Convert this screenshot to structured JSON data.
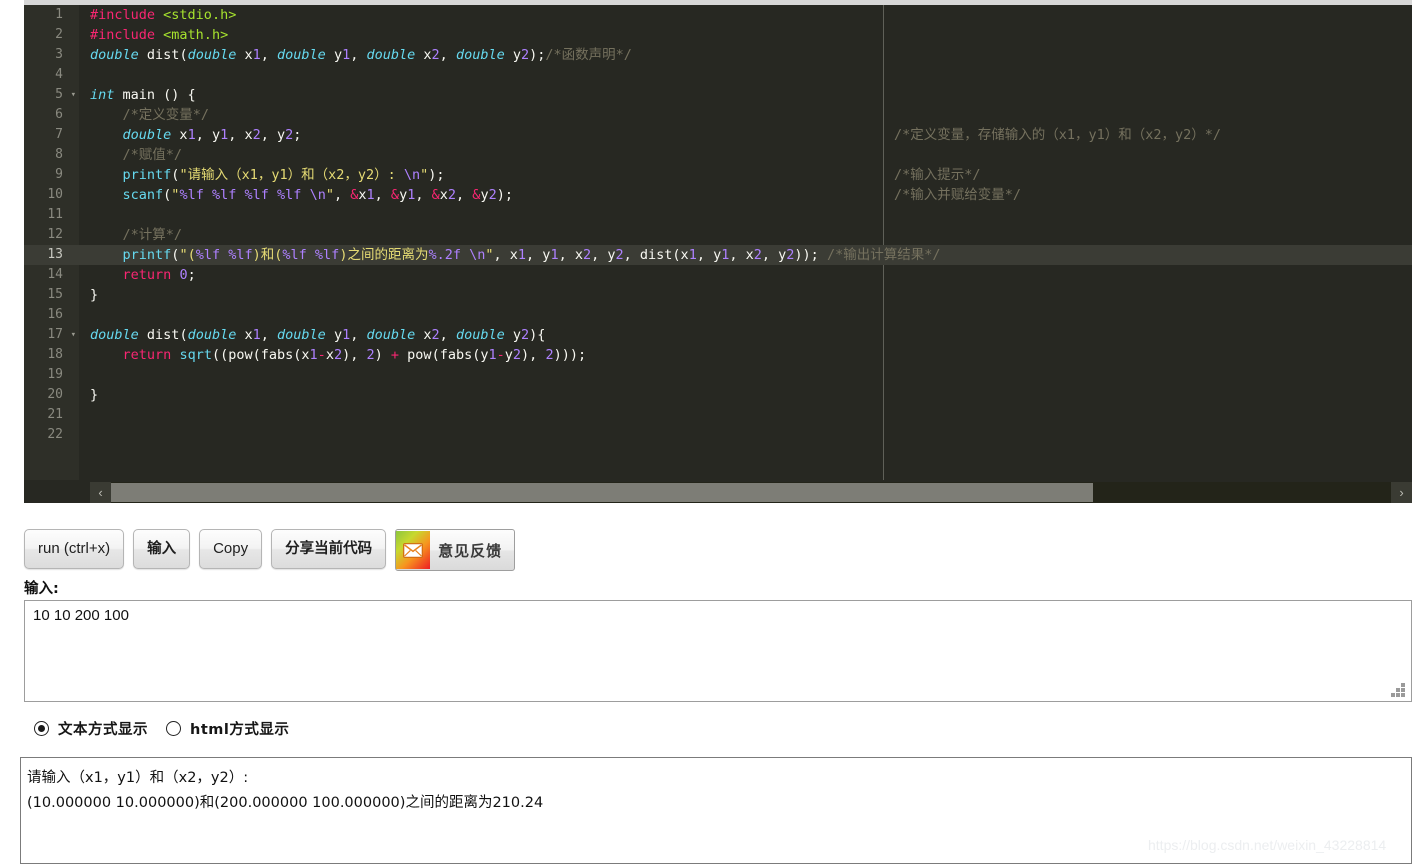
{
  "editor": {
    "background_color": "#272822",
    "gutter_color": "#2e2f28",
    "active_line": 13,
    "ruler_column_color": "#5f6058",
    "line_numbers": [
      "1",
      "2",
      "3",
      "4",
      "5",
      "6",
      "7",
      "8",
      "9",
      "10",
      "11",
      "12",
      "13",
      "14",
      "15",
      "16",
      "17",
      "18",
      "19",
      "20",
      "21",
      "22"
    ],
    "fold_markers": [
      5,
      17
    ],
    "lines": [
      {
        "n": 1,
        "code": "#include <stdio.h>",
        "tail_comment": ""
      },
      {
        "n": 2,
        "code": "#include <math.h>",
        "tail_comment": ""
      },
      {
        "n": 3,
        "code": "double dist(double x1, double y1, double x2, double y2);/*函数声明*/",
        "tail_comment": ""
      },
      {
        "n": 4,
        "code": "",
        "tail_comment": ""
      },
      {
        "n": 5,
        "code": "int main () {",
        "tail_comment": ""
      },
      {
        "n": 6,
        "code": "    /*定义变量*/",
        "tail_comment": ""
      },
      {
        "n": 7,
        "code": "    double x1, y1, x2, y2;",
        "tail_comment": "/*定义变量，存储输入的（x1，y1）和（x2，y2）*/"
      },
      {
        "n": 8,
        "code": "    /*赋值*/",
        "tail_comment": ""
      },
      {
        "n": 9,
        "code": "    printf(\"请输入（x1，y1）和（x2，y2）: \\n\");",
        "tail_comment": "/*输入提示*/"
      },
      {
        "n": 10,
        "code": "    scanf(\"%lf %lf %lf %lf \\n\", &x1, &y1, &x2, &y2);",
        "tail_comment": "/*输入并赋给变量*/"
      },
      {
        "n": 11,
        "code": "",
        "tail_comment": ""
      },
      {
        "n": 12,
        "code": "    /*计算*/",
        "tail_comment": ""
      },
      {
        "n": 13,
        "code": "    printf(\"(%lf %lf)和(%lf %lf)之间的距离为%.2f \\n\", x1, y1, x2, y2, dist(x1, y1, x2, y2)); /*输出计算结果*/",
        "tail_comment": ""
      },
      {
        "n": 14,
        "code": "    return 0;",
        "tail_comment": ""
      },
      {
        "n": 15,
        "code": "}",
        "tail_comment": ""
      },
      {
        "n": 16,
        "code": "",
        "tail_comment": ""
      },
      {
        "n": 17,
        "code": "double dist(double x1, double y1, double x2, double y2){",
        "tail_comment": ""
      },
      {
        "n": 18,
        "code": "    return sqrt((pow(fabs(x1-x2), 2) + pow(fabs(y1-y2), 2)));",
        "tail_comment": ""
      },
      {
        "n": 19,
        "code": "",
        "tail_comment": ""
      },
      {
        "n": 20,
        "code": "}",
        "tail_comment": ""
      },
      {
        "n": 21,
        "code": "",
        "tail_comment": ""
      },
      {
        "n": 22,
        "code": "",
        "tail_comment": ""
      }
    ],
    "scrollbar": {
      "left_arrow": "‹",
      "right_arrow": "›"
    }
  },
  "toolbar": {
    "run_label": "run (ctrl+x)",
    "input_label": "输入",
    "copy_label": "Copy",
    "share_label": "分享当前代码",
    "feedback_label": "意见反馈",
    "feedback_icon": "mail-icon"
  },
  "input_section": {
    "label": "输入:",
    "value": "10 10 200 100",
    "placeholder": ""
  },
  "display_mode": {
    "options": [
      {
        "label": "文本方式显示",
        "checked": true
      },
      {
        "label": "html方式显示",
        "checked": false
      }
    ]
  },
  "output": {
    "lines": [
      "请输入（x1，y1）和（x2，y2）:",
      "(10.000000 10.000000)和(200.000000 100.000000)之间的距离为210.24"
    ]
  },
  "watermark": {
    "text": "https://blog.csdn.net/weixin_43228814"
  }
}
